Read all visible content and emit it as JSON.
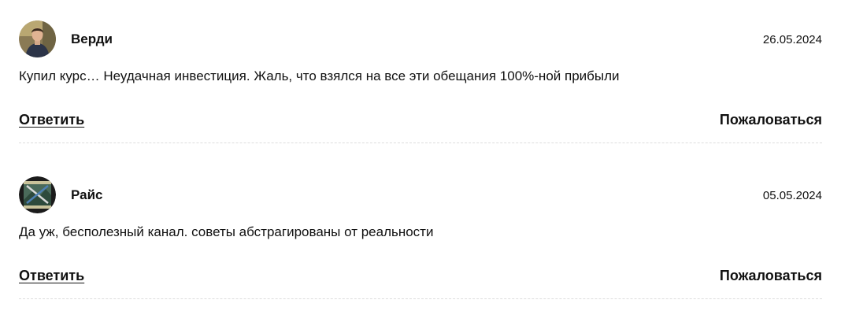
{
  "comments": [
    {
      "author": "Верди",
      "date": "26.05.2024",
      "text": "Купил курс… Неудачная инвестиция. Жаль, что взялся на все эти обещания 100%-ной прибыли",
      "reply_label": "Ответить",
      "report_label": "Пожаловаться",
      "avatar_icon": "user-photo-avatar"
    },
    {
      "author": "Райс",
      "date": "05.05.2024",
      "text": "Да уж, бесполезный канал. советы абстрагированы от реальности",
      "reply_label": "Ответить",
      "report_label": "Пожаловаться",
      "avatar_icon": "user-picture-avatar"
    }
  ],
  "colors": {
    "text": "#111111",
    "divider": "#dddddd",
    "background": "#ffffff"
  }
}
